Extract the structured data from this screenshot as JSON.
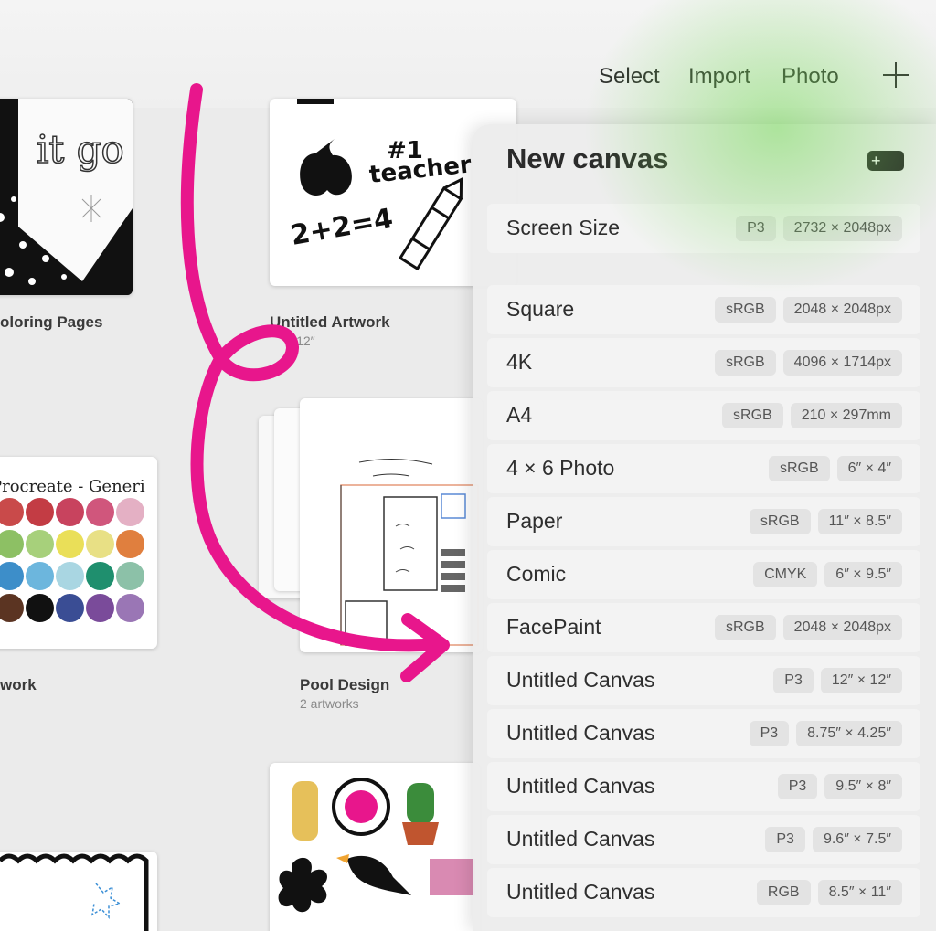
{
  "toolbar": {
    "select_label": "Select",
    "import_label": "Import",
    "photo_label": "Photo",
    "add_icon": "plus-icon"
  },
  "gallery": {
    "items": [
      {
        "title": "oloring Pages",
        "subtitle": ""
      },
      {
        "title": "Untitled Artwork",
        "subtitle": "× 12″"
      },
      {
        "title": "work",
        "subtitle": ""
      },
      {
        "title": "Pool Design",
        "subtitle": "2 artworks"
      }
    ],
    "sketch_text": {
      "teacher_1": "#1",
      "teacher_2": "teacher",
      "math": "2+2=4",
      "palette_title": "Procreate - Generi",
      "letitgo": "it go"
    },
    "palette_colors": [
      "#c94a4a",
      "#c33c44",
      "#c8435e",
      "#d0567c",
      "#e4b0c4",
      "#8dc064",
      "#a7d07b",
      "#eadf58",
      "#e8e085",
      "#e07f3e",
      "#3d8ec9",
      "#6cb6dd",
      "#a9d6e2",
      "#1f8f6e",
      "#8cc1a8",
      "#5b3422",
      "#111111",
      "#3a4d94",
      "#7a4b9a",
      "#9a76b5"
    ]
  },
  "popover": {
    "title": "New canvas",
    "folder_icon": "new-folder-icon",
    "screen_size": {
      "name": "Screen Size",
      "profile": "P3",
      "size": "2732 × 2048px"
    },
    "presets": [
      {
        "name": "Square",
        "profile": "sRGB",
        "size": "2048 × 2048px"
      },
      {
        "name": "4K",
        "profile": "sRGB",
        "size": "4096 × 1714px"
      },
      {
        "name": "A4",
        "profile": "sRGB",
        "size": "210 × 297mm"
      },
      {
        "name": "4 × 6 Photo",
        "profile": "sRGB",
        "size": "6″ × 4″"
      },
      {
        "name": "Paper",
        "profile": "sRGB",
        "size": "11″ × 8.5″"
      },
      {
        "name": "Comic",
        "profile": "CMYK",
        "size": "6″ × 9.5″"
      },
      {
        "name": "FacePaint",
        "profile": "sRGB",
        "size": "2048 × 2048px"
      },
      {
        "name": "Untitled Canvas",
        "profile": "P3",
        "size": "12″ × 12″"
      },
      {
        "name": "Untitled Canvas",
        "profile": "P3",
        "size": "8.75″ × 4.25″"
      },
      {
        "name": "Untitled Canvas",
        "profile": "P3",
        "size": "9.5″ × 8″"
      },
      {
        "name": "Untitled Canvas",
        "profile": "P3",
        "size": "9.6″ × 7.5″"
      },
      {
        "name": "Untitled Canvas",
        "profile": "RGB",
        "size": "8.5″ × 11″"
      }
    ]
  },
  "colors": {
    "arrow": "#e8168c",
    "accent_glow": "#78dc5a"
  }
}
